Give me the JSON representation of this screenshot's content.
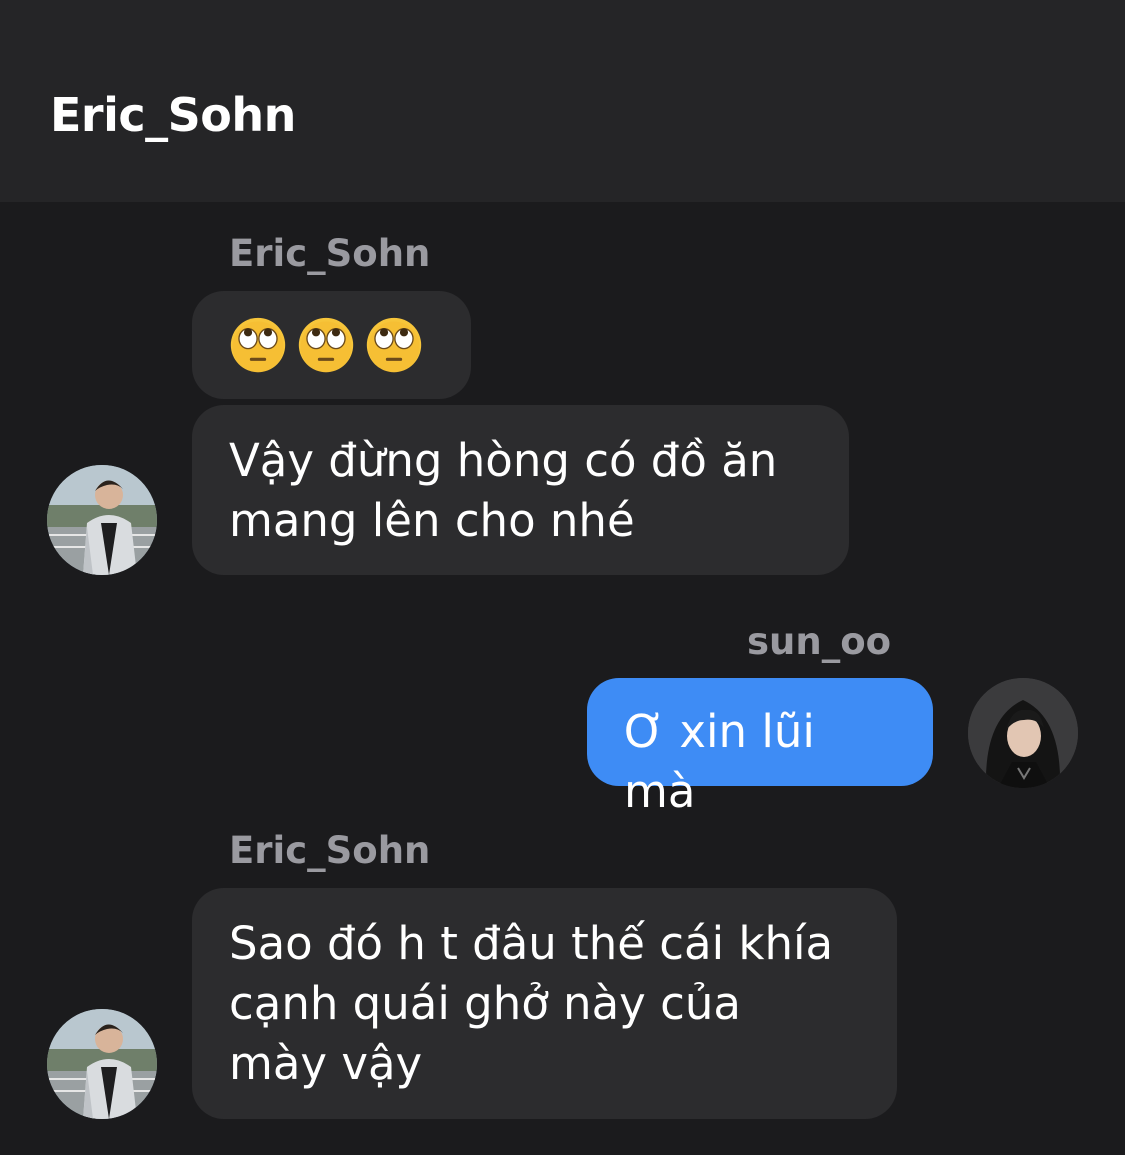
{
  "header": {
    "title": "Eric_Sohn"
  },
  "messages": [
    {
      "sender": "Eric_Sohn",
      "direction": "incoming",
      "emojis": [
        "face-with-rolling-eyes",
        "face-with-rolling-eyes",
        "face-with-rolling-eyes"
      ]
    },
    {
      "direction": "incoming",
      "line1": "Vậy đừng hòng có đồ ăn",
      "line2": "mang lên cho nhé"
    },
    {
      "sender": "sun_oo",
      "direction": "outgoing",
      "text": "Ơ xin lũi mà"
    },
    {
      "sender": "Eric_Sohn",
      "direction": "incoming",
      "line1": "Sao đó h t đâu thế cái khía",
      "line2": "cạnh quái ghở này của",
      "line3": "mày vậy"
    }
  ],
  "colors": {
    "background": "#1b1b1d",
    "header_background": "#252527",
    "incoming_bubble": "#2c2c2e",
    "outgoing_bubble": "#3e8cf5",
    "sender_label": "#9a9aa0"
  }
}
